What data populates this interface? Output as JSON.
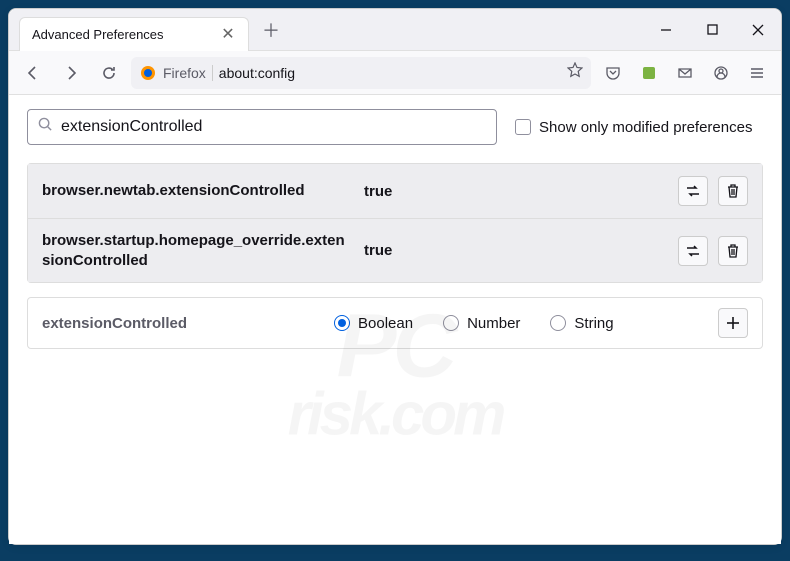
{
  "titlebar": {
    "tab_title": "Advanced Preferences"
  },
  "toolbar": {
    "identity_label": "Firefox",
    "url": "about:config"
  },
  "search": {
    "value": "extensionControlled",
    "checkbox_label": "Show only modified preferences",
    "checked": false
  },
  "prefs": [
    {
      "name": "browser.newtab.extensionControlled",
      "value": "true",
      "modified": true
    },
    {
      "name": "browser.startup.homepage_override.extensionControlled",
      "value": "true",
      "modified": true
    }
  ],
  "newpref": {
    "name": "extensionControlled",
    "types": [
      "Boolean",
      "Number",
      "String"
    ],
    "selected": "Boolean"
  },
  "watermark": {
    "line1": "PC",
    "line2": "risk.com"
  }
}
